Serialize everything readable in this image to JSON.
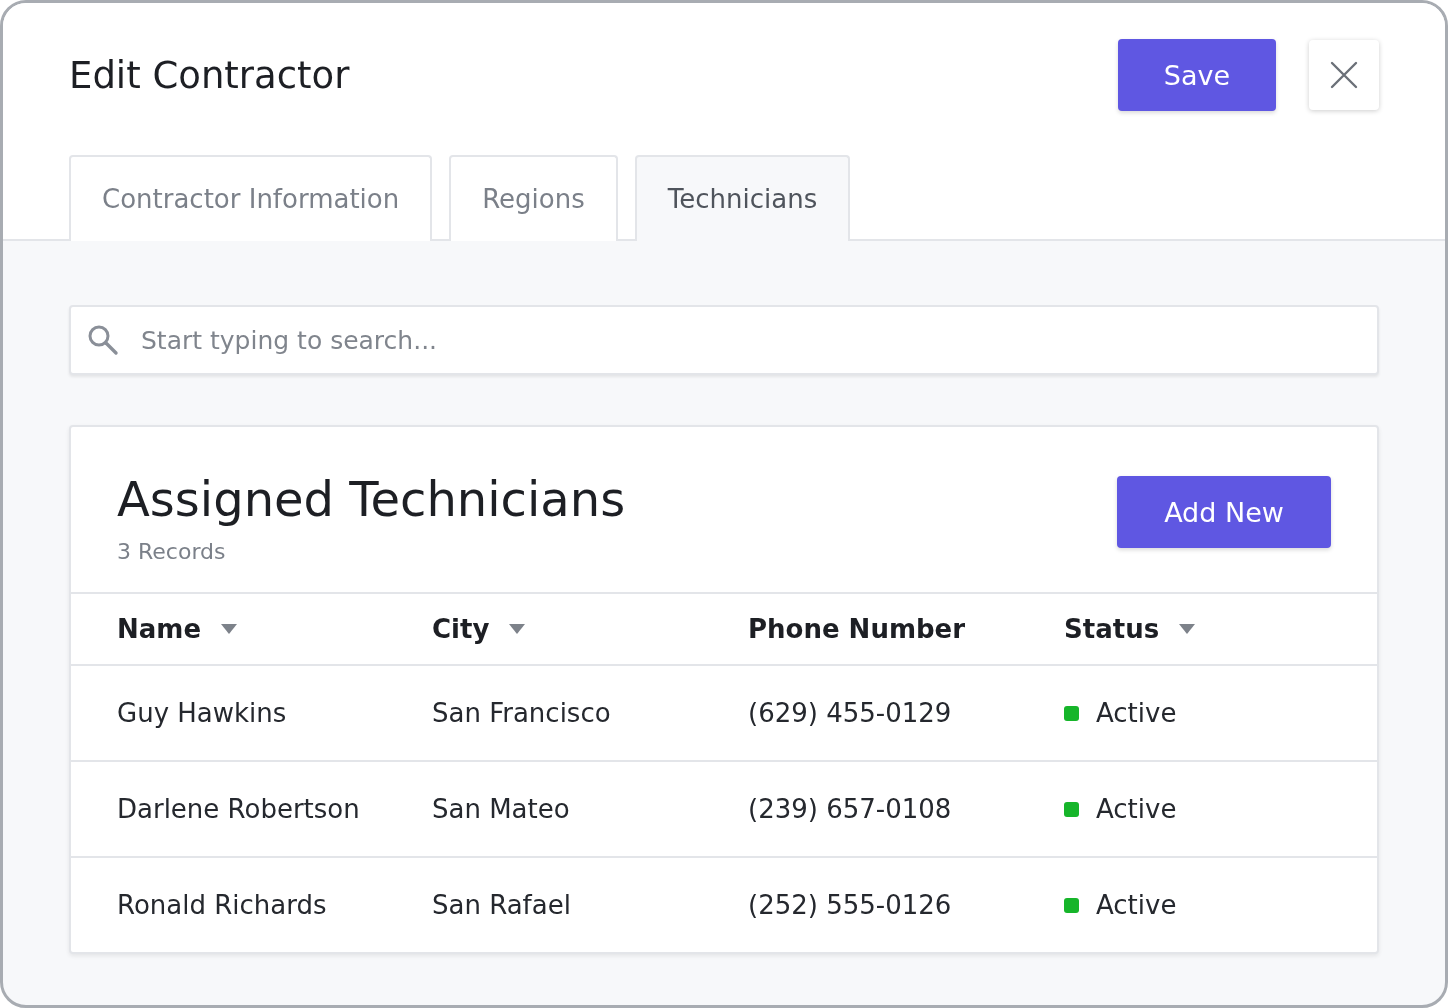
{
  "window": {
    "title": "Edit Contractor"
  },
  "actions": {
    "save": "Save"
  },
  "tabs": [
    {
      "label": "Contractor Information",
      "selected": false
    },
    {
      "label": "Regions",
      "selected": false
    },
    {
      "label": "Technicians",
      "selected": true
    }
  ],
  "search": {
    "placeholder": "Start typing to search..."
  },
  "card": {
    "title": "Assigned Technicians",
    "count": "3 Records",
    "add_button": "Add New"
  },
  "table": {
    "columns": [
      {
        "label": "Name",
        "sortable": true
      },
      {
        "label": "City",
        "sortable": true
      },
      {
        "label": "Phone Number",
        "sortable": false
      },
      {
        "label": "Status",
        "sortable": true
      }
    ],
    "rows": [
      {
        "name": "Guy Hawkins",
        "city": "San Francisco",
        "phone": "(629) 455-0129",
        "status": "Active",
        "color": "#16b52a"
      },
      {
        "name": "Darlene Robertson",
        "city": "San Mateo",
        "phone": "(239) 657-0108",
        "status": "Active",
        "color": "#16b52a"
      },
      {
        "name": "Ronald Richards",
        "city": "San Rafael",
        "phone": "(252) 555-0126",
        "status": "Active",
        "color": "#16b52a"
      }
    ]
  }
}
